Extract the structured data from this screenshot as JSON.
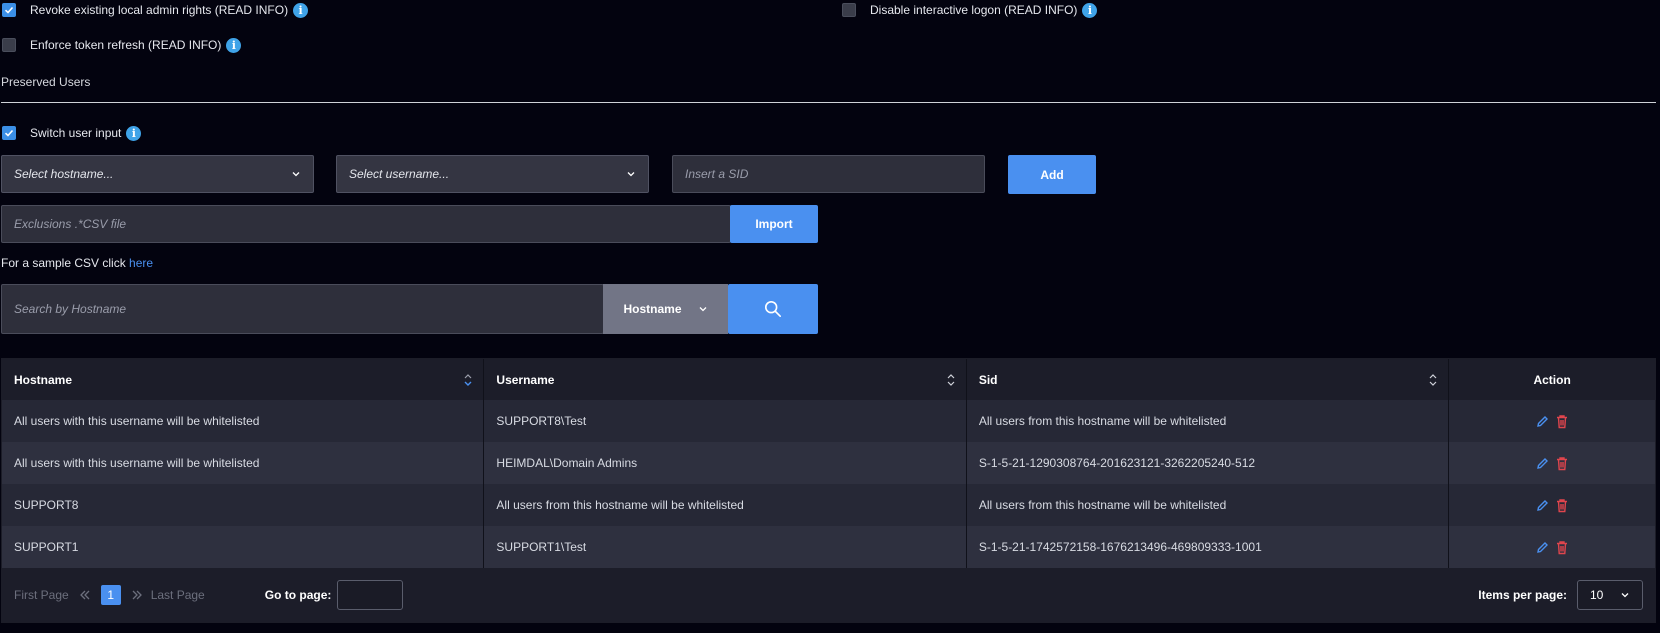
{
  "options": {
    "revoke_label": "Revoke existing local admin rights (READ INFO)",
    "revoke_checked": true,
    "disable_logon_label": "Disable interactive logon (READ INFO)",
    "disable_logon_checked": false,
    "token_refresh_label": "Enforce token refresh (READ INFO)",
    "token_refresh_checked": false
  },
  "preserved": {
    "title": "Preserved Users",
    "switch_label": "Switch user input",
    "switch_checked": true,
    "hostname_select": "Select hostname...",
    "username_select": "Select username...",
    "sid_placeholder": "Insert a SID",
    "add_label": "Add",
    "csv_placeholder": "Exclusions .*CSV file",
    "import_label": "Import",
    "sample_text": "For a sample CSV click",
    "sample_link": "here"
  },
  "search": {
    "placeholder": "Search by Hostname",
    "filter_value": "Hostname"
  },
  "table": {
    "headers": {
      "hostname": "Hostname",
      "username": "Username",
      "sid": "Sid",
      "action": "Action"
    },
    "rows": [
      {
        "hostname": "All users with this username will be whitelisted",
        "username": "SUPPORT8\\Test",
        "sid": "All users from this hostname will be whitelisted"
      },
      {
        "hostname": "All users with this username will be whitelisted",
        "username": "HEIMDAL\\Domain Admins",
        "sid": "S-1-5-21-1290308764-201623121-3262205240-512"
      },
      {
        "hostname": "SUPPORT8",
        "username": "All users from this hostname will be whitelisted",
        "sid": "All users from this hostname will be whitelisted"
      },
      {
        "hostname": "SUPPORT1",
        "username": "SUPPORT1\\Test",
        "sid": "S-1-5-21-1742572158-1676213496-469809333-1001"
      }
    ]
  },
  "pagination": {
    "first": "First Page",
    "last": "Last Page",
    "current": "1",
    "goto_label": "Go to page:",
    "items_label": "Items per page:",
    "items_value": "10"
  },
  "colors": {
    "accent": "#4a90f0",
    "background": "#03030f",
    "delete": "#e0454d",
    "info": "#3fa3e8"
  }
}
